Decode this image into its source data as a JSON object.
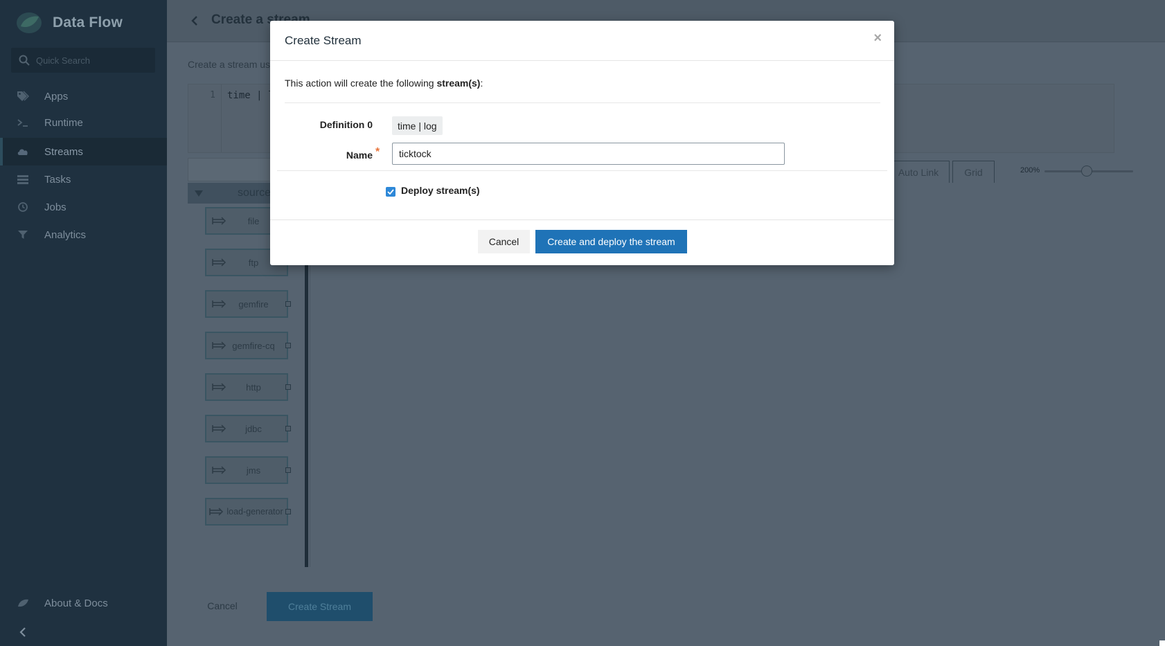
{
  "app": {
    "name": "Data Flow"
  },
  "sidebar": {
    "search_placeholder": "Quick Search",
    "items": [
      {
        "label": "Apps",
        "icon": "tags-icon"
      },
      {
        "label": "Runtime",
        "icon": "terminal-icon"
      },
      {
        "label": "Streams",
        "icon": "cloud-icon"
      },
      {
        "label": "Tasks",
        "icon": "list-icon"
      },
      {
        "label": "Jobs",
        "icon": "clock-icon"
      },
      {
        "label": "Analytics",
        "icon": "funnel-icon"
      }
    ],
    "active": "Streams",
    "about": "About & Docs"
  },
  "page": {
    "title": "Create a stream",
    "description": "Create a stream usi",
    "editor": {
      "line_number": "1",
      "code": "time | l"
    },
    "toolbar": {
      "auto_link": "Auto Link",
      "grid": "Grid",
      "zoom": "200%"
    },
    "palette": {
      "group": "source",
      "items": [
        "file",
        "ftp",
        "gemfire",
        "gemfire-cq",
        "http",
        "jdbc",
        "jms",
        "load-generator"
      ]
    },
    "footer": {
      "cancel": "Cancel",
      "create": "Create Stream"
    }
  },
  "modal": {
    "title": "Create Stream",
    "close": "×",
    "intro_text": "This action will create the following ",
    "intro_bold": "stream(s)",
    "intro_suffix": ":",
    "definition_label": "Definition 0",
    "definition_value": "time | log",
    "name_label": "Name",
    "required_mark": "*",
    "name_value": "ticktock",
    "deploy_label": "Deploy stream(s)",
    "deploy_checked": true,
    "cancel_label": "Cancel",
    "create_label": "Create and deploy the stream"
  },
  "colors": {
    "primary": "#1f73b7",
    "sidebar": "#1f3140",
    "required": "#e8743b",
    "checkbox": "#2e88d8"
  }
}
